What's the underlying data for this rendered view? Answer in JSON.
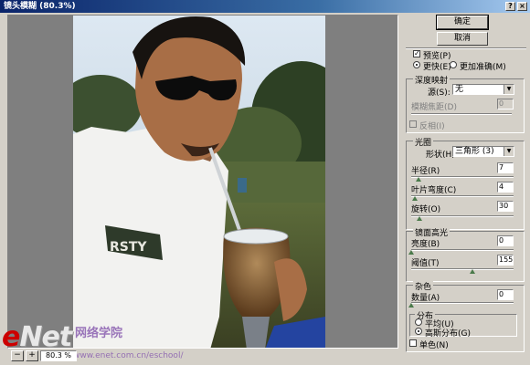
{
  "window": {
    "title": "镜头模糊 (80.3%)"
  },
  "buttons": {
    "ok": "确定",
    "cancel": "取消"
  },
  "preview": {
    "checkbox": "预览(P)",
    "checked": true,
    "faster": "更快(E)",
    "more_accurate": "更加准确(M)",
    "selected": "faster"
  },
  "depth_map": {
    "title": "深度映射",
    "source_label": "源(S):",
    "source_value": "无",
    "blur_focal_label": "模糊焦距(D)",
    "blur_focal_value": "0",
    "invert_label": "反相(I)"
  },
  "iris": {
    "title": "光圈",
    "shape_label": "形状(H):",
    "shape_value": "三角形 (3)",
    "radius_label": "半径(R)",
    "radius_value": "7",
    "radius_level": 0.07,
    "blade_curvature_label": "叶片弯度(C)",
    "blade_curvature_value": "4",
    "blade_curvature_level": 0.04,
    "rotation_label": "旋转(O)",
    "rotation_value": "30",
    "rotation_level": 0.08
  },
  "specular": {
    "title": "镜面高光",
    "brightness_label": "亮度(B)",
    "brightness_value": "0",
    "brightness_level": 0.0,
    "threshold_label": "阈值(T)",
    "threshold_value": "155",
    "threshold_level": 0.6
  },
  "noise": {
    "title": "杂色",
    "amount_label": "数量(A)",
    "amount_value": "0",
    "amount_level": 0.0,
    "distribution_title": "分布",
    "uniform": "平均(U)",
    "gaussian": "高斯分布(G)",
    "selected": "gaussian",
    "mono_label": "单色(N)"
  },
  "zoom": {
    "minus": "−",
    "plus": "+",
    "value": "80.3 %"
  },
  "watermark": {
    "logo_e": "e",
    "logo_net": "Net",
    "cn": "网络学院",
    "url": "www.enet.com.cn/eschool/"
  }
}
